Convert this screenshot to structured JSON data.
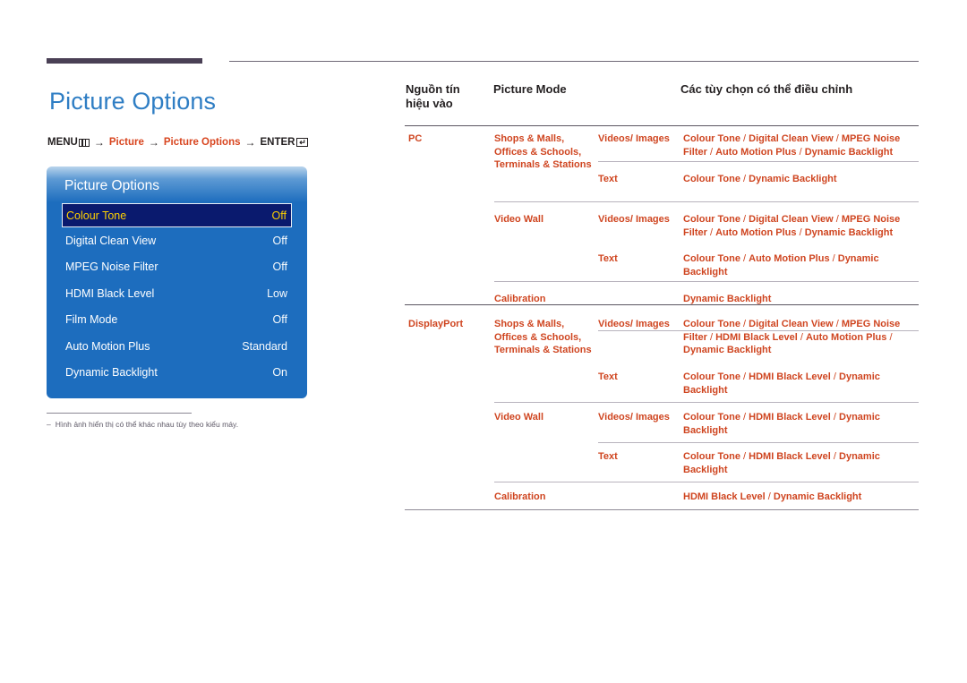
{
  "page": {
    "title": "Picture Options",
    "breadcrumb": {
      "menu_label": "MENU",
      "menu_icon": "menu-bars-icon",
      "arrow": "→",
      "crumb1": "Picture",
      "crumb2": "Picture Options",
      "enter_label": "ENTER",
      "enter_icon": "enter-return-icon",
      "enter_glyph": "↵"
    },
    "footnote": {
      "marker": "–",
      "text": "Hình ảnh hiển thị có thể khác nhau tùy theo kiểu máy."
    },
    "colors": {
      "title_blue": "#2f7ec4",
      "accent_orange": "#cf4520",
      "crumb_orange": "#d8451f",
      "osd_blue": "#1d6dbe",
      "osd_selected_bg": "#0a1a6e",
      "osd_selected_text": "#ffd200",
      "top_rule": "#4a4055"
    }
  },
  "osd": {
    "title": "Picture Options",
    "items": [
      {
        "label": "Colour Tone",
        "value": "Off",
        "selected": true
      },
      {
        "label": "Digital Clean View",
        "value": "Off",
        "selected": false
      },
      {
        "label": "MPEG Noise Filter",
        "value": "Off",
        "selected": false
      },
      {
        "label": "HDMI Black Level",
        "value": "Low",
        "selected": false
      },
      {
        "label": "Film Mode",
        "value": "Off",
        "selected": false
      },
      {
        "label": "Auto Motion Plus",
        "value": "Standard",
        "selected": false
      },
      {
        "label": "Dynamic Backlight",
        "value": "On",
        "selected": false
      }
    ]
  },
  "table": {
    "headers": {
      "source": "Nguồn tín hiệu vào",
      "source_line1": "Nguồn tín",
      "source_line2": "hiệu vào",
      "mode": "Picture Mode",
      "options": "Các tùy chọn có thể điều chỉnh"
    },
    "rows": [
      {
        "source": "PC",
        "mode": "Shops & Malls, Offices & Schools, Terminals & Stations",
        "sub": "Videos/ Images",
        "options": "Colour Tone / Digital Clean View / MPEG Noise Filter / Auto Motion Plus / Dynamic Backlight"
      },
      {
        "source": "",
        "mode": "",
        "sub": "Text",
        "options": "Colour Tone / Dynamic Backlight"
      },
      {
        "source": "",
        "mode": "Video Wall",
        "sub": "Videos/ Images",
        "options": "Colour Tone / Digital Clean View / MPEG Noise Filter / Auto Motion Plus / Dynamic Backlight"
      },
      {
        "source": "",
        "mode": "",
        "sub": "Text",
        "options": "Colour Tone / Auto Motion Plus / Dynamic Backlight"
      },
      {
        "source": "",
        "mode": "Calibration",
        "sub": "",
        "options": "Dynamic Backlight"
      },
      {
        "source": "DisplayPort",
        "mode": "Shops & Malls, Offices & Schools, Terminals & Stations",
        "sub": "Videos/ Images",
        "options": "Colour Tone / Digital Clean View / MPEG Noise Filter / HDMI Black Level / Auto Motion Plus / Dynamic Backlight"
      },
      {
        "source": "",
        "mode": "",
        "sub": "Text",
        "options": "Colour Tone / HDMI Black Level / Dynamic Backlight"
      },
      {
        "source": "",
        "mode": "Video Wall",
        "sub": "Videos/ Images",
        "options": "Colour Tone / HDMI Black Level / Dynamic Backlight"
      },
      {
        "source": "",
        "mode": "",
        "sub": "Text",
        "options": "Colour Tone / HDMI Black Level / Dynamic Backlight"
      },
      {
        "source": "",
        "mode": "Calibration",
        "sub": "",
        "options": "HDMI Black Level / Dynamic Backlight"
      }
    ]
  }
}
